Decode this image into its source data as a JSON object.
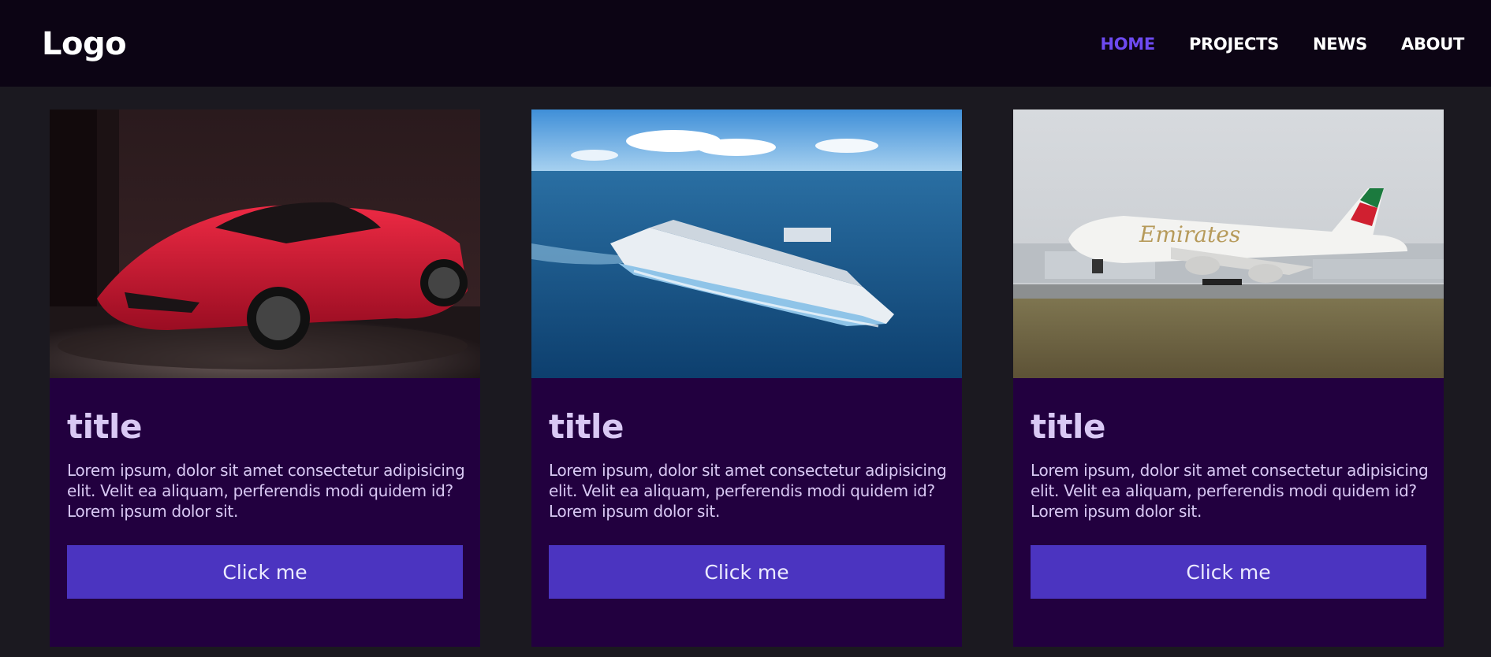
{
  "header": {
    "logo": "Logo",
    "nav": [
      {
        "label": "HOME",
        "active": true
      },
      {
        "label": "PROJECTS",
        "active": false
      },
      {
        "label": "NEWS",
        "active": false
      },
      {
        "label": "ABOUT",
        "active": false
      }
    ]
  },
  "cards": [
    {
      "image": "red-sports-car-photo",
      "title": "title",
      "text": "Lorem ipsum, dolor sit amet consectetur adipisicing elit. Velit ea aliquam, perferendis modi quidem id?Lorem ipsum dolor sit.",
      "button": "Click me"
    },
    {
      "image": "cruise-ship-photo",
      "title": "title",
      "text": "Lorem ipsum, dolor sit amet consectetur adipisicing elit. Velit ea aliquam, perferendis modi quidem id?Lorem ipsum dolor sit.",
      "button": "Click me"
    },
    {
      "image": "airplane-photo",
      "title": "title",
      "text": "Lorem ipsum, dolor sit amet consectetur adipisicing elit. Velit ea aliquam, perferendis modi quidem id?Lorem ipsum dolor sit.",
      "button": "Click me"
    }
  ],
  "colors": {
    "page_background": "#1b1920",
    "navbar": "#0c0414",
    "active_nav": "#6d4af0",
    "card": "#22003f",
    "button": "#4b34c0"
  }
}
